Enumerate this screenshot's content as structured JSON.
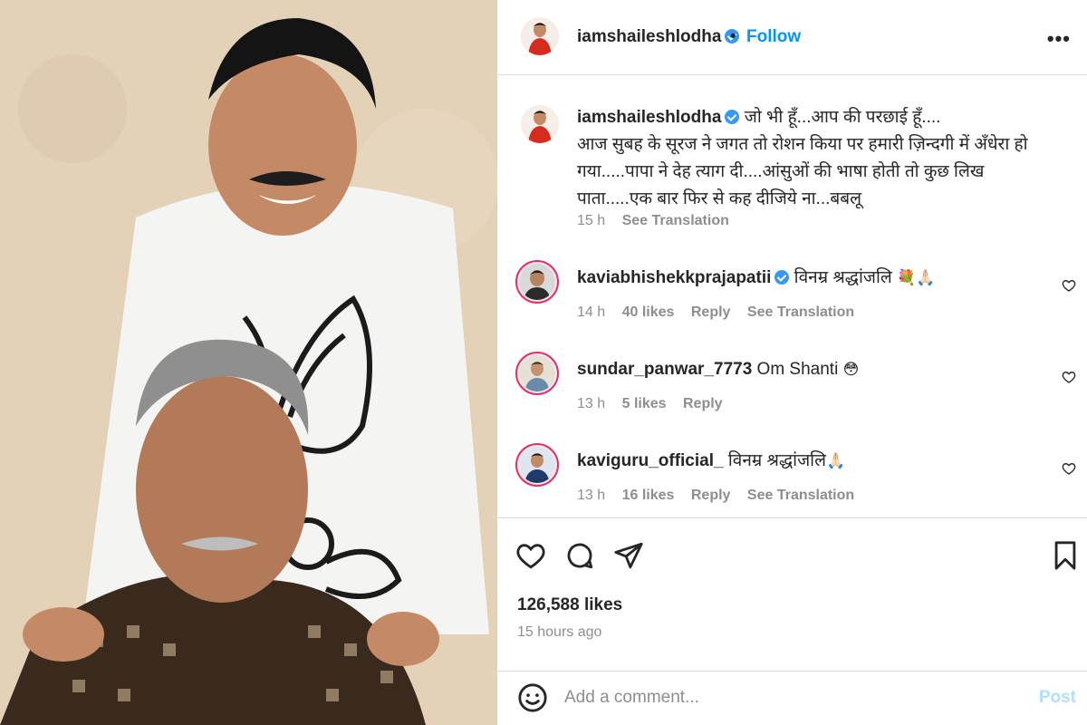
{
  "post": {
    "author": "iamshaileshlodha",
    "follow_label": "Follow",
    "separator": "•",
    "more_label": "•••",
    "caption_lines": [
      "जो भी हूँ...आप की परछाई हूँ....",
      "आज सुबह के सूरज ने जगत तो रोशन किया पर हमारी ज़िन्दगी में अँधेरा हो",
      "गया.....पापा ने देह त्याग दी....आंसुओं की भाषा होती तो कुछ लिख",
      "पाता.....एक बार फिर से कह दीजिये ना...बबलू"
    ],
    "caption_time": "15 h",
    "see_translation": "See Translation"
  },
  "comments": [
    {
      "user": "kaviabhishekkprajapatii",
      "verified": true,
      "text": "विनम्र श्रद्धांजलि",
      "emoji": "💐🙏🏻",
      "time": "14 h",
      "likes": "40 likes",
      "reply": "Reply",
      "translation": "See Translation"
    },
    {
      "user": "sundar_panwar_7773",
      "verified": false,
      "text": "Om Shanti",
      "emoji": "😳",
      "time": "13 h",
      "likes": "5 likes",
      "reply": "Reply",
      "translation": ""
    },
    {
      "user": "kaviguru_official_",
      "verified": false,
      "text": "विनम्र श्रद्धांजलि",
      "emoji": "🙏🏻",
      "time": "13 h",
      "likes": "16 likes",
      "reply": "Reply",
      "translation": "See Translation"
    }
  ],
  "actions": {
    "like_icon": "heart-icon",
    "comment_icon": "comment-bubble-icon",
    "share_icon": "paper-plane-icon",
    "save_icon": "bookmark-icon"
  },
  "stats": {
    "likes": "126,588 likes",
    "posted": "15 hours ago"
  },
  "add_comment": {
    "placeholder": "Add a comment...",
    "post_label": "Post"
  },
  "colors": {
    "link_blue": "#0095f6",
    "post_disabled": "#b2dffc",
    "muted": "#8e8e8e",
    "ring": "#e1306c"
  }
}
